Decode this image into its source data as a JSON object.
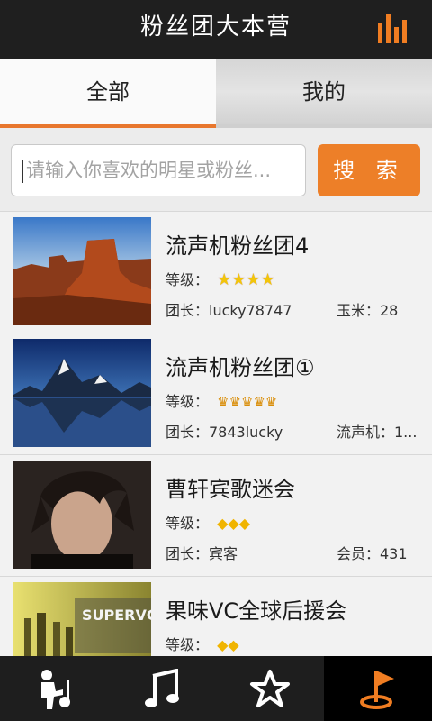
{
  "header": {
    "title": "粉丝团大本营",
    "menu_icon": "bars-chart-icon"
  },
  "tabs": [
    {
      "label": "全部",
      "active": true
    },
    {
      "label": "我的",
      "active": false
    }
  ],
  "search": {
    "placeholder": "请输入你喜欢的明星或粉丝...",
    "button_label": "搜 索"
  },
  "list": [
    {
      "name": "流声机粉丝团4",
      "level_label": "等级：",
      "level_glyph": "star",
      "level_count": 4,
      "leader": "团长：lucky78747",
      "stat": "玉米：28"
    },
    {
      "name": "流声机粉丝团①",
      "level_label": "等级：",
      "level_glyph": "crown",
      "level_count": 5,
      "leader": "团长：7843lucky",
      "stat": "流声机：1..."
    },
    {
      "name": "曹轩宾歌迷会",
      "level_label": "等级：",
      "level_glyph": "diamond",
      "level_count": 3,
      "leader": "团长：宾客",
      "stat": "会员：431"
    },
    {
      "name": "果味VC全球后援会",
      "level_label": "等级：",
      "level_glyph": "diamond",
      "level_count": 2,
      "leader": "",
      "stat": ""
    }
  ],
  "bottom_nav": [
    {
      "icon": "singer-icon",
      "active": false
    },
    {
      "icon": "music-note-icon",
      "active": false
    },
    {
      "icon": "star-icon",
      "active": false
    },
    {
      "icon": "flag-icon",
      "active": true
    }
  ],
  "colors": {
    "accent": "#ed7f28",
    "header_bg": "#1f1f1f",
    "nav_bg": "#1e1e1e"
  }
}
